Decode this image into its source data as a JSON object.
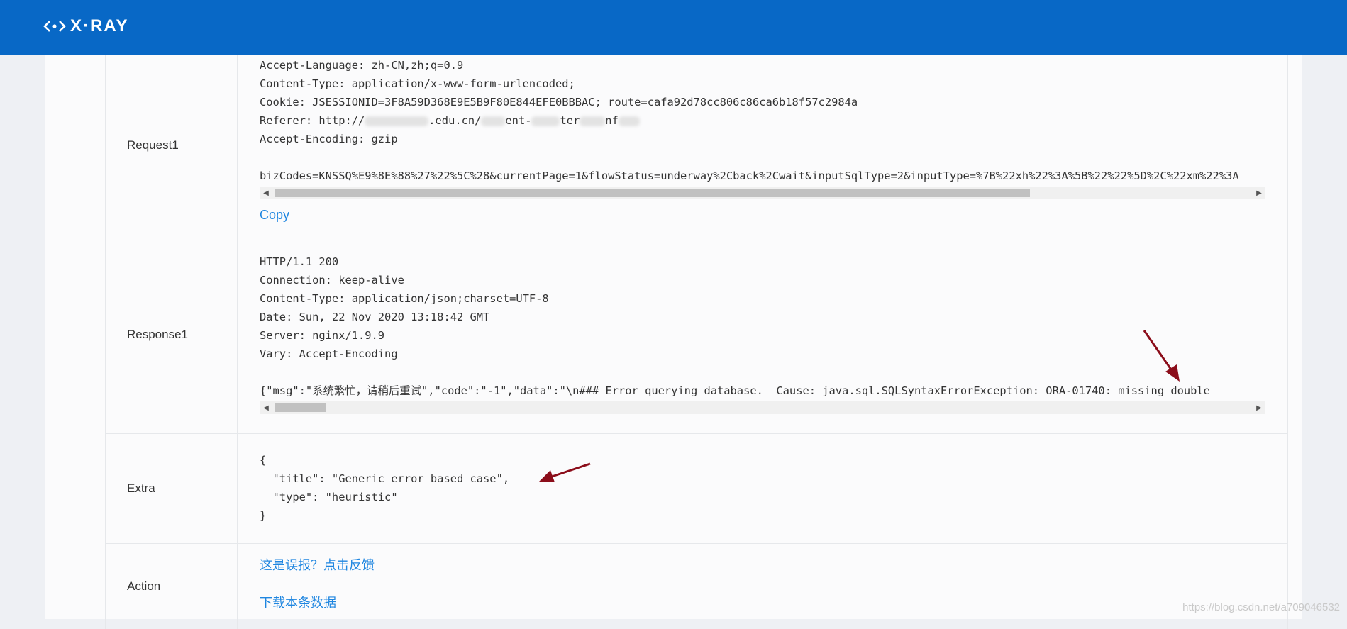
{
  "header": {
    "brand": "X·RAY",
    "color": "#0868c6"
  },
  "rows": {
    "request": {
      "label": "Request1",
      "lines": [
        "Accept-Language: zh-CN,zh;q=0.9",
        "Content-Type: application/x-www-form-urlencoded;",
        "Cookie: JSESSIONID=3F8A59D368E9E5B9F80E844EFE0BBBAC; route=cafa92d78cc806c86ca6b18f57c2984a"
      ],
      "referer_prefix": "Referer: http://",
      "referer_mid": ".edu.cn/",
      "referer_tail_a": "ent-",
      "referer_tail_b": "ter",
      "referer_tail_c": "nf",
      "encoding": "Accept-Encoding: gzip",
      "body": "bizCodes=KNSSQ%E9%8E%88%27%22%5C%28&currentPage=1&flowStatus=underway%2Cback%2Cwait&inputSqlType=2&inputType=%7B%22xh%22%3A%5B%22%22%5D%2C%22xm%22%3A",
      "copy_label": "Copy"
    },
    "response": {
      "label": "Response1",
      "lines": [
        "HTTP/1.1 200",
        "Connection: keep-alive",
        "Content-Type: application/json;charset=UTF-8",
        "Date: Sun, 22 Nov 2020 13:18:42 GMT",
        "Server: nginx/1.9.9",
        "Vary: Accept-Encoding"
      ],
      "body": "{\"msg\":\"系统繁忙，请稍后重试\",\"code\":\"-1\",\"data\":\"\\n### Error querying database.  Cause: java.sql.SQLSyntaxErrorException: ORA-01740: missing double"
    },
    "extra": {
      "label": "Extra",
      "lines": [
        "{",
        "  \"title\": \"Generic error based case\",",
        "  \"type\": \"heuristic\"",
        "}"
      ]
    },
    "action": {
      "label": "Action",
      "feedback_link": "这是误报？点击反馈",
      "download_link": "下载本条数据"
    }
  },
  "watermark": "https://blog.csdn.net/a709046532",
  "arrow_color": "#8b0d1a"
}
